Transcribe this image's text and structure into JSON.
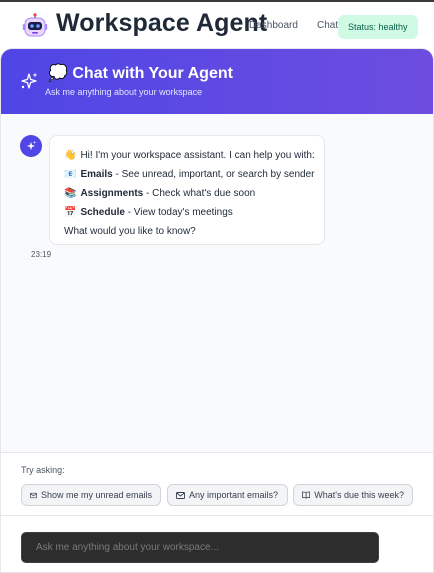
{
  "header": {
    "app_title": "Workspace Agent",
    "logo_icon": "robot-icon",
    "nav": [
      {
        "label": "Dashboard"
      },
      {
        "label": "Chat"
      }
    ],
    "status": "Status: healthy"
  },
  "chat": {
    "title": "💭 Chat with Your Agent",
    "subtitle": "Ask me anything about your workspace",
    "header_icon": "sparkles-icon",
    "message": {
      "greeting_emoji": "👋",
      "greeting": "Hi! I'm your workspace assistant. I can help you with:",
      "items": [
        {
          "emoji": "📧",
          "title": "Emails",
          "desc": " - See unread, important, or search by sender"
        },
        {
          "emoji": "📚",
          "title": "Assignments",
          "desc": " - Check what's due soon"
        },
        {
          "emoji": "📅",
          "title": "Schedule",
          "desc": " - View today's meetings"
        }
      ],
      "closing": "What would you like to know?",
      "time": "23:19"
    }
  },
  "suggestions": {
    "label": "Try asking:",
    "chips": [
      {
        "icon": "mail-icon",
        "label": "Show me my unread emails"
      },
      {
        "icon": "mail-icon",
        "label": "Any important emails?"
      },
      {
        "icon": "book-icon",
        "label": "What's due this week?"
      }
    ]
  },
  "input": {
    "placeholder": "Ask me anything about your workspace...",
    "value": ""
  },
  "colors": {
    "accent": "#4f46e5",
    "status_bg": "#d1fae5",
    "status_text": "#065f46"
  }
}
